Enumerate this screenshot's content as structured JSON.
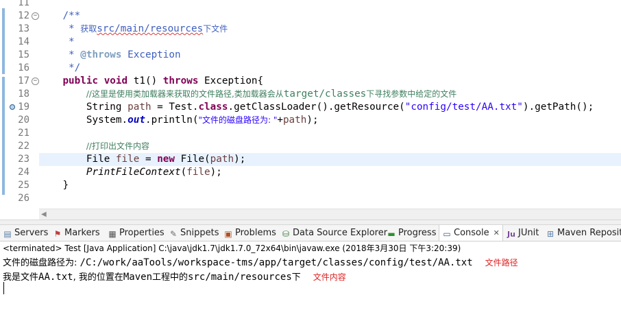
{
  "editor": {
    "line_numbers": [
      "11",
      "12",
      "13",
      "14",
      "15",
      "16",
      "17",
      "18",
      "19",
      "20",
      "21",
      "22",
      "23",
      "24",
      "25",
      "26"
    ],
    "javadoc_open": "/**",
    "javadoc_star": "*",
    "javadoc_desc_prefix": "获取",
    "javadoc_desc_path": "src/main/resources",
    "javadoc_desc_suffix": "下文件",
    "javadoc_throws_tag": "@throws",
    "javadoc_throws_value": "Exception",
    "javadoc_close": "*/",
    "kw_public": "public",
    "kw_void": "void",
    "method_decl": " t1() ",
    "kw_throws": "throws",
    "decl_tail": " Exception{",
    "comment1_prefix": "//这里是使用类加载器来获取的文件路径,类加载器会从",
    "comment1_path": "target/classes",
    "comment1_suffix": "下寻找参数中给定的文件",
    "l19_type": "String ",
    "l19_var": "path",
    "l19_mid1": " = Test.",
    "kw_class": "class",
    "l19_mid2": ".getClassLoader().getResource(",
    "l19_str": "\"config/test/AA.txt\"",
    "l19_end": ").getPath();",
    "l20_a": "System.",
    "l20_out": "out",
    "l20_b": ".println(",
    "l20_str_cn": "\"文件的磁盘路径为: \"",
    "l20_c": "+",
    "l20_var": "path",
    "l20_d": ");",
    "comment2": "//打印出文件内容",
    "l23_type": "File ",
    "l23_var": "file",
    "l23_eq": " = ",
    "kw_new": "new",
    "l23_call": " File(",
    "l23_arg": "path",
    "l23_end": ");",
    "l24_call": "PrintFileContext",
    "l24_open": "(",
    "l24_arg": "file",
    "l24_end": ");",
    "close_brace": "}"
  },
  "tabs": [
    {
      "label": "Servers",
      "icon": "servers-icon"
    },
    {
      "label": "Markers",
      "icon": "markers-icon"
    },
    {
      "label": "Properties",
      "icon": "properties-icon"
    },
    {
      "label": "Snippets",
      "icon": "snippets-icon"
    },
    {
      "label": "Problems",
      "icon": "problems-icon"
    },
    {
      "label": "Data Source Explorer",
      "icon": "data-source-icon"
    },
    {
      "label": "Progress",
      "icon": "progress-icon"
    },
    {
      "label": "Console",
      "icon": "console-icon",
      "close": "✕"
    },
    {
      "label": "JUnit",
      "icon": "junit-icon"
    },
    {
      "label": "Maven Reposito",
      "icon": "maven-icon"
    }
  ],
  "console": {
    "status": "<terminated> Test [Java Application] C:\\java\\jdk1.7\\jdk1.7.0_72x64\\bin\\javaw.exe (2018年3月30日 下午3:20:39)",
    "line1_label": "文件的磁盘路径为: ",
    "line1_path": "/C:/work/aaTools/workspace-tms/app/target/classes/config/test/AA.txt",
    "line1_note": "文件路径",
    "line2_a": "我是文件",
    "line2_b": "AA.txt",
    "line2_c": ", 我的位置在",
    "line2_d": "Maven",
    "line2_e": "工程中的",
    "line2_f": "src/main/resources",
    "line2_g": "下",
    "line2_note": "文件内容"
  },
  "colors": {
    "keyword": "#7f0055",
    "comment": "#3f7f5f",
    "javadoc": "#3f5fbf",
    "string": "#2a00ff",
    "field": "#0000c0",
    "annotation_red": "#e02020"
  }
}
